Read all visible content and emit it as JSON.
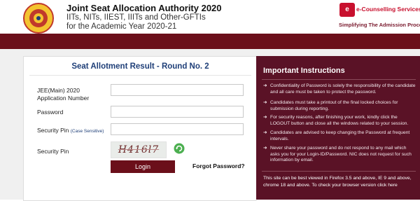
{
  "header": {
    "title": "Joint Seat Allocation Authority 2020",
    "subtitle": "IITs, NITs, IIEST, IIITs and Other-GFTIs for the Academic Year 2020-21",
    "brand_badge": "e",
    "brand_name": "e-Counselling Services",
    "brand_tagline": "Simplifying The Admission Process"
  },
  "form": {
    "title": "Seat Allotment Result - Round No. 2",
    "app_label_line1": "JEE(Main) 2020",
    "app_label_line2": "Application Number",
    "password_label": "Password",
    "security_pin_label": "Security Pin",
    "case_note": "(Case Sensitive)",
    "security_pin_image_label": "Security Pin",
    "captcha_text": "H416l7",
    "app_value": "",
    "password_value": "",
    "pin_value": "",
    "login_label": "Login",
    "forgot_label": "Forgot Password?"
  },
  "instructions": {
    "title": "Important Instructions",
    "items": [
      "Confidentiality of Password is solely the responsibility of the candidate and all care must be taken to protect the password.",
      "Candidates must take a printout of the final locked choices for submission during reporting.",
      "For security reasons, after finishing your work, kindly click the LOGOUT button and close all the windows related to your session.",
      "Candidates are advised to keep changing the Password at frequent intervals.",
      "Never share your password and do not respond to any mail which asks you for your Login-ID/Password. NIC does not request for such information by email."
    ],
    "browser_note": "This site can be best viewed in Firefox 3.5 and above, IE 9 and above, chrome 18 and above. To check your browser version",
    "click_here": "click here"
  },
  "colors": {
    "maroon": "#6b0f1a",
    "panel": "#5a1226",
    "title_blue": "#1f3f78"
  },
  "icons": {
    "refresh": "refresh-icon",
    "arrow": "arrow-right-icon",
    "logo": "jossa-logo-icon"
  }
}
